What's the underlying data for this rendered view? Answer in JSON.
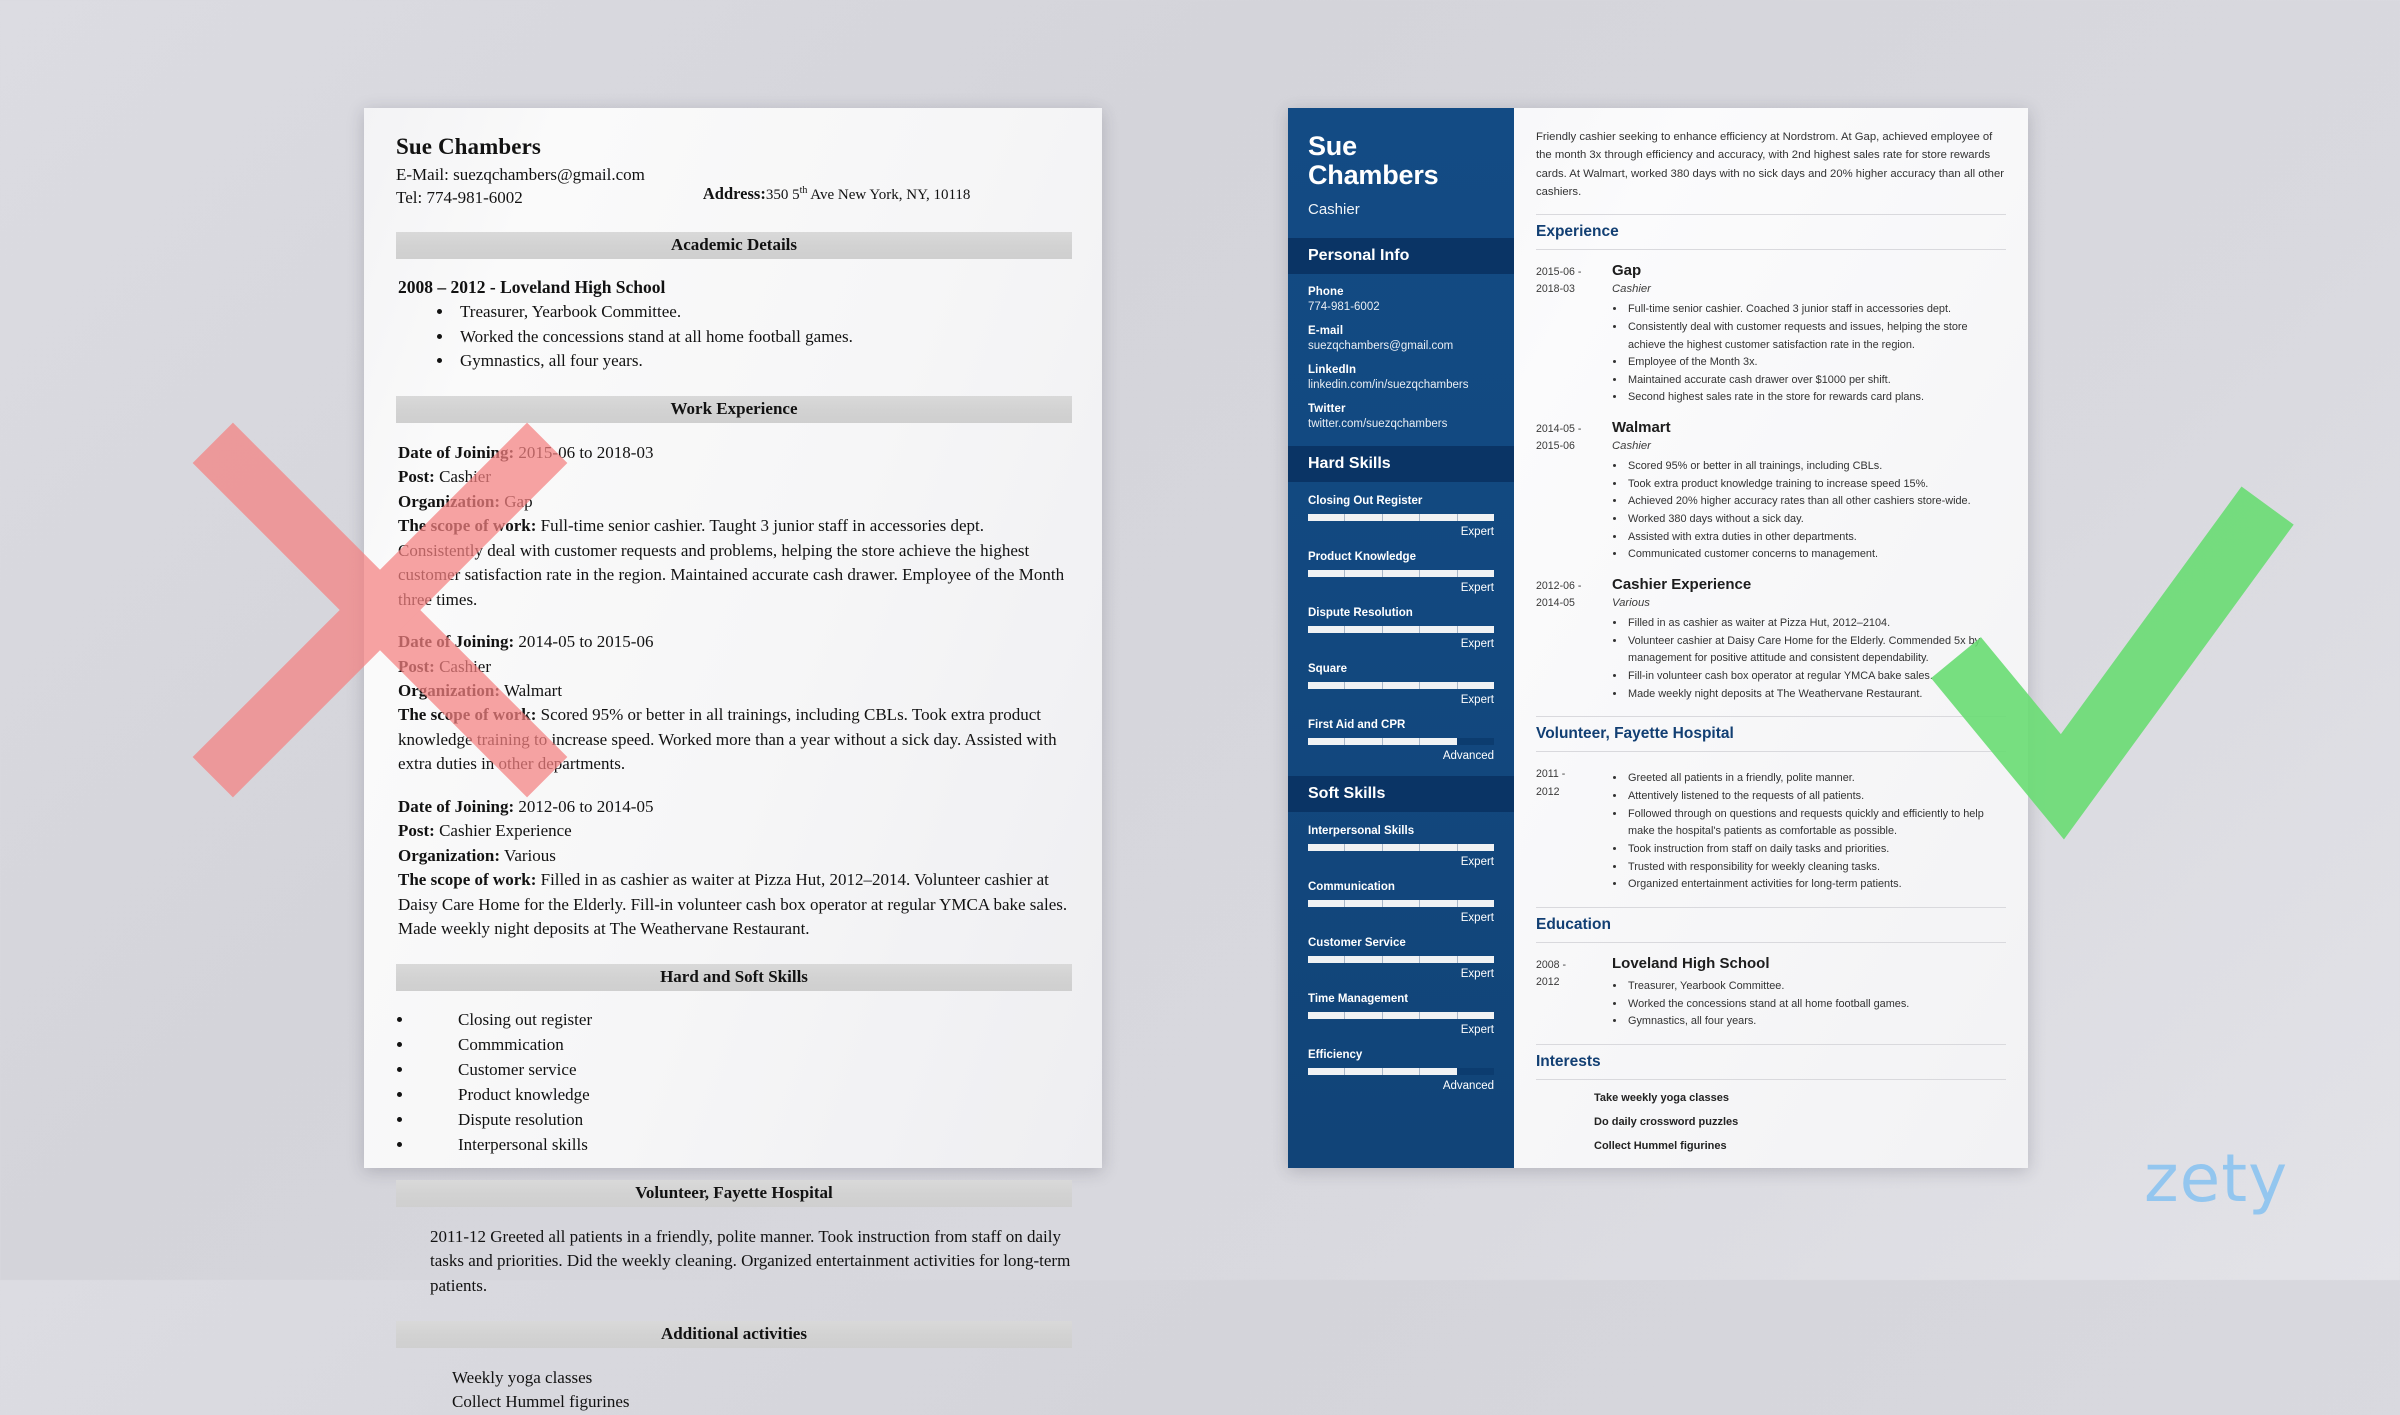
{
  "colors": {
    "navy_sidebar": "#134b84",
    "navy_band": "#0a3465",
    "accent_heading": "#123f73",
    "mark_red": "#f58181",
    "mark_green": "#6add74",
    "logo_blue": "#93c6ef",
    "band_gray": "#d4d4d4"
  },
  "brand": {
    "logo": "zety"
  },
  "marks": {
    "bad_icon": "red-x-mark",
    "good_icon": "green-check-mark"
  },
  "bad_resume": {
    "name": "Sue Chambers",
    "email_line": "E-Mail: suezqchambers@gmail.com",
    "tel_line": "Tel: 774-981-6002",
    "address_label": "Address:",
    "address_value_a": "350 5",
    "address_value_sup": "th",
    "address_value_b": " Ave New York, NY, 10118",
    "sections": {
      "academic": {
        "band": "Academic Details",
        "school_line": "2008 – 2012 - Loveland High School",
        "bullets": [
          "Treasurer, Yearbook Committee.",
          "Worked the concessions stand at all home football games.",
          "Gymnastics, all four years."
        ]
      },
      "work": {
        "band": "Work Experience",
        "labels": {
          "date": "Date of Joining:",
          "post": "Post:",
          "org": "Organization:",
          "scope": "The scope of work:"
        },
        "jobs": [
          {
            "date": " 2015-06 to 2018-03",
            "post": " Cashier",
            "org": " Gap",
            "scope": " Full-time senior cashier. Taught 3 junior staff in accessories dept. Consistently deal with customer requests and problems, helping the store achieve the highest customer satisfaction rate in the region. Maintained accurate cash drawer. Employee of the Month three times."
          },
          {
            "date": " 2014-05 to 2015-06",
            "post": " Cashier",
            "org": " Walmart",
            "scope": " Scored 95% or better in all trainings, including CBLs. Took extra product knowledge training to increase speed. Worked more than a year without a sick day. Assisted with extra duties in other departments."
          },
          {
            "date": " 2012-06 to 2014-05",
            "post": " Cashier Experience",
            "org": " Various",
            "scope": " Filled in as cashier as waiter at Pizza Hut, 2012–2014. Volunteer cashier at Daisy Care Home for the Elderly. Fill-in volunteer cash box operator at regular YMCA bake sales. Made weekly night deposits at The Weathervane Restaurant."
          }
        ]
      },
      "skills": {
        "band": "Hard and Soft Skills",
        "items": [
          "Closing out register",
          "Commmication",
          "Customer service",
          "Product knowledge",
          "Dispute resolution",
          "Interpersonal skills"
        ]
      },
      "volunteer": {
        "band": "Volunteer, Fayette Hospital",
        "paragraph": "2011-12 Greeted all patients in a friendly, polite manner. Took instruction from staff on daily tasks and priorities. Did the weekly cleaning. Organized entertainment activities for long-term patients."
      },
      "additional": {
        "band": "Additional activities",
        "lines": [
          "Weekly yoga classes",
          "Collect Hummel figurines"
        ]
      }
    }
  },
  "good_resume": {
    "sidebar": {
      "name_line1": "Sue",
      "name_line2": "Chambers",
      "role": "Cashier",
      "personal_info": {
        "band": "Personal Info",
        "items": [
          {
            "label": "Phone",
            "value": "774-981-6002"
          },
          {
            "label": "E-mail",
            "value": "suezqchambers@gmail.com"
          },
          {
            "label": "LinkedIn",
            "value": "linkedin.com/in/suezqchambers"
          },
          {
            "label": "Twitter",
            "value": "twitter.com/suezqchambers"
          }
        ]
      },
      "hard_skills": {
        "band": "Hard Skills",
        "items": [
          {
            "name": "Closing Out Register",
            "level": "Expert",
            "percent": 100
          },
          {
            "name": "Product Knowledge",
            "level": "Expert",
            "percent": 100
          },
          {
            "name": "Dispute Resolution",
            "level": "Expert",
            "percent": 100
          },
          {
            "name": "Square",
            "level": "Expert",
            "percent": 100
          },
          {
            "name": "First Aid and CPR",
            "level": "Advanced",
            "percent": 80
          }
        ]
      },
      "soft_skills": {
        "band": "Soft Skills",
        "items": [
          {
            "name": "Interpersonal Skills",
            "level": "Expert",
            "percent": 100
          },
          {
            "name": "Communication",
            "level": "Expert",
            "percent": 100
          },
          {
            "name": "Customer Service",
            "level": "Expert",
            "percent": 100
          },
          {
            "name": "Time Management",
            "level": "Expert",
            "percent": 100
          },
          {
            "name": "Efficiency",
            "level": "Advanced",
            "percent": 80
          }
        ]
      }
    },
    "main": {
      "summary": "Friendly cashier seeking to enhance efficiency at Nordstrom. At Gap, achieved employee of the month 3x through efficiency and accuracy, with 2nd highest sales rate for store rewards cards. At Walmart, worked 380 days with no sick days and 20% higher accuracy than all other cashiers.",
      "sections": [
        {
          "title": "Experience",
          "entries": [
            {
              "dates": "2015-06 -\n2018-03",
              "org": "Gap",
              "role": "Cashier",
              "bullets": [
                "Full-time senior cashier. Coached 3 junior staff in accessories dept.",
                "Consistently deal with customer requests and issues, helping the store achieve the highest customer satisfaction rate in the region.",
                "Employee of the Month 3x.",
                "Maintained accurate cash drawer over $1000 per shift.",
                "Second highest sales rate in the store for rewards card plans."
              ]
            },
            {
              "dates": "2014-05 -\n2015-06",
              "org": "Walmart",
              "role": "Cashier",
              "bullets": [
                "Scored 95% or better in all trainings, including CBLs.",
                "Took extra product knowledge training to increase speed 15%.",
                "Achieved 20% higher accuracy rates than all other cashiers store-wide.",
                "Worked 380 days without a sick day.",
                "Assisted with extra duties in other departments.",
                "Communicated customer concerns to management."
              ]
            },
            {
              "dates": "2012-06 -\n2014-05",
              "org": "Cashier Experience",
              "role": "Various",
              "bullets": [
                "Filled in as cashier as waiter at Pizza Hut, 2012–2104.",
                "Volunteer cashier at Daisy Care Home for the Elderly. Commended 5x by management for positive attitude and consistent dependability.",
                "Fill-in volunteer cash box operator at regular YMCA bake sales.",
                "Made weekly night deposits at The Weathervane Restaurant."
              ]
            }
          ]
        },
        {
          "title": "Volunteer, Fayette Hospital",
          "entries": [
            {
              "dates": "2011 -\n2012",
              "org": "",
              "role": "",
              "bullets": [
                "Greeted all patients in a friendly, polite manner.",
                "Attentively listened to the requests of all patients.",
                "Followed through on questions and requests quickly and efficiently to help make the hospital's patients as comfortable as possible.",
                "Took instruction from staff on daily tasks and priorities.",
                "Trusted with responsibility for weekly cleaning tasks.",
                "Organized entertainment activities for long-term patients."
              ]
            }
          ]
        },
        {
          "title": "Education",
          "entries": [
            {
              "dates": "2008 -\n2012",
              "org": "Loveland High School",
              "role": "",
              "bullets": [
                "Treasurer, Yearbook Committee.",
                "Worked the concessions stand at all home football games.",
                "Gymnastics, all four years."
              ]
            }
          ]
        }
      ],
      "interests": {
        "title": "Interests",
        "items": [
          "Take weekly yoga classes",
          "Do daily crossword puzzles",
          "Collect Hummel figurines"
        ]
      }
    }
  }
}
